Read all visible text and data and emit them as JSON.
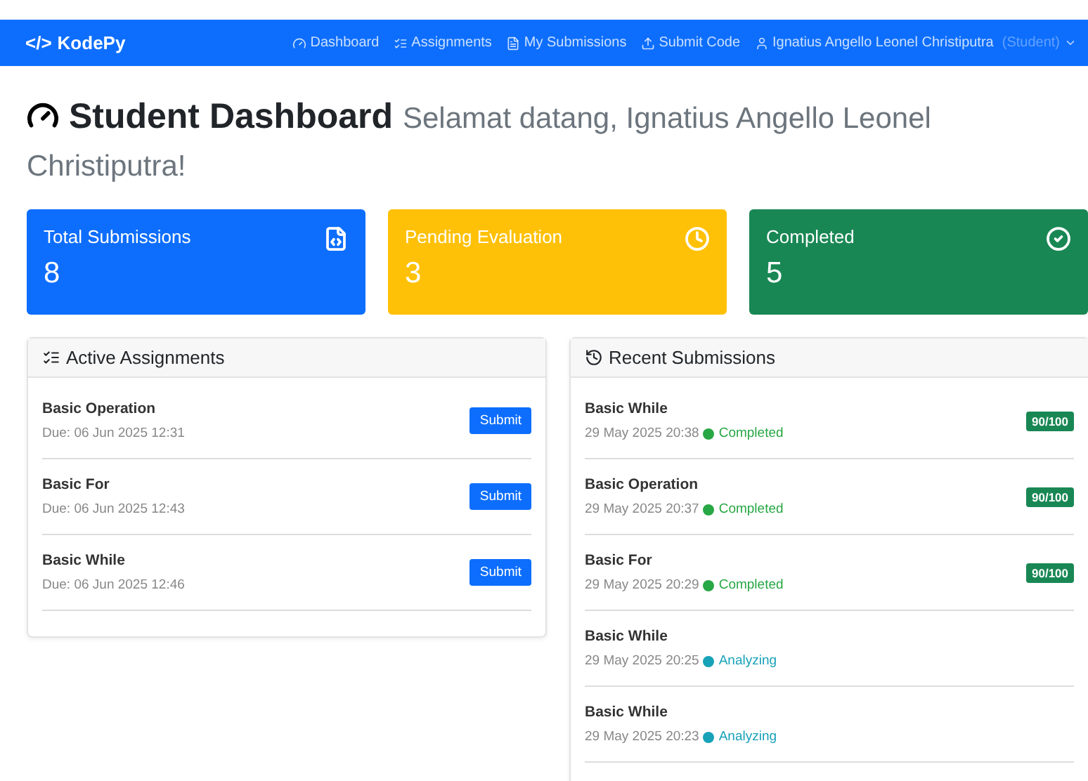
{
  "navbar": {
    "logo": "</>",
    "brand": "KodePy",
    "links": [
      {
        "label": "Dashboard"
      },
      {
        "label": "Assignments"
      },
      {
        "label": "My Submissions"
      },
      {
        "label": "Submit Code"
      }
    ],
    "user": {
      "name": "Ignatius Angello Leonel Christiputra",
      "role": "(Student)"
    }
  },
  "heading": {
    "title": "Student Dashboard",
    "subtitle": "Selamat datang, Ignatius Angello Leonel Christiputra!"
  },
  "stats": [
    {
      "label": "Total Submissions",
      "value": "8",
      "color": "#0d6efd"
    },
    {
      "label": "Pending Evaluation",
      "value": "3",
      "color": "#ffc107"
    },
    {
      "label": "Completed",
      "value": "5",
      "color": "#198754"
    }
  ],
  "active_assignments": {
    "title": "Active Assignments",
    "items": [
      {
        "name": "Basic Operation",
        "due": "Due: 06 Jun 2025 12:31",
        "button": "Submit"
      },
      {
        "name": "Basic For",
        "due": "Due: 06 Jun 2025 12:43",
        "button": "Submit"
      },
      {
        "name": "Basic While",
        "due": "Due: 06 Jun 2025 12:46",
        "button": "Submit"
      }
    ]
  },
  "recent_submissions": {
    "title": "Recent Submissions",
    "items": [
      {
        "name": "Basic While",
        "date": "29 May 2025 20:38",
        "status": "Completed",
        "color": "#28a745",
        "score": "90/100"
      },
      {
        "name": "Basic Operation",
        "date": "29 May 2025 20:37",
        "status": "Completed",
        "color": "#28a745",
        "score": "90/100"
      },
      {
        "name": "Basic For",
        "date": "29 May 2025 20:29",
        "status": "Completed",
        "color": "#28a745",
        "score": "90/100"
      },
      {
        "name": "Basic While",
        "date": "29 May 2025 20:25",
        "status": "Analyzing",
        "color": "#17a2b8"
      },
      {
        "name": "Basic While",
        "date": "29 May 2025 20:23",
        "status": "Analyzing",
        "color": "#17a2b8"
      }
    ]
  }
}
